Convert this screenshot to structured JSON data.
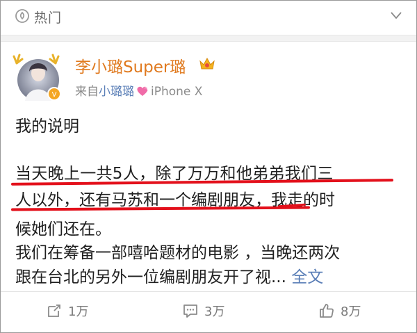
{
  "header": {
    "section_title": "热门"
  },
  "post": {
    "author": "李小璐Super璐",
    "source_prefix": "来自",
    "source_name": "小璐璐",
    "source_device": "iPhone X",
    "lines": [
      "我的说明",
      "当天晚上一共5人，除了万万和他弟弟我们三",
      "人以外，还有马苏和一个编剧朋友，我走的时",
      "候她们还在。",
      "我们在筹备一部嘻哈题材的电影 ，当晚还两次",
      "跟在台北的另外一位编剧朋友开了视..."
    ],
    "more_link": "全文"
  },
  "actions": {
    "repost_count": "1万",
    "comment_count": "3万",
    "like_count": "8万"
  },
  "colors": {
    "author": "#e07a1f",
    "link": "#5b7fb7",
    "highlight_marker": "#e3101b",
    "muted": "#7a7a7a"
  },
  "icons": [
    "hot-topic-icon",
    "chevron-down-icon",
    "vip-crown-icon",
    "heart-icon",
    "repost-icon",
    "comment-icon",
    "like-icon"
  ]
}
